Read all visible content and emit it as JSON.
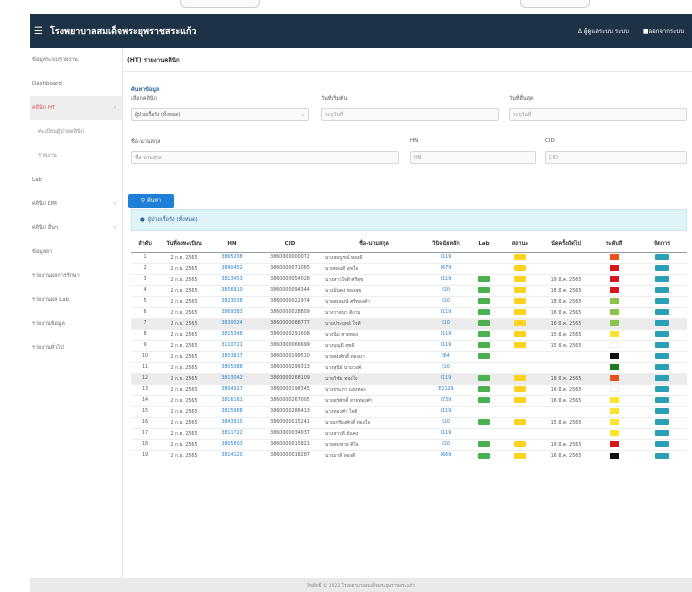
{
  "navbar": {
    "title": "โรงพยาบาลสมเด็จพระยุพราชสระแก้ว",
    "user_label": "Δ ผู้ดูแลระบบ ระบบ",
    "logout_label": "ออกจากระบบ"
  },
  "sidebar": {
    "items": [
      {
        "label": "ข้อมูลระบบรายงาน",
        "chevron": ""
      },
      {
        "label": "Dashboard",
        "chevron": ""
      },
      {
        "label": "คลินิก HT",
        "chevron": "‹"
      },
      {
        "label": "ทะเบียนผู้ป่วยคลินิก",
        "chevron": ""
      },
      {
        "label": "รายงาน",
        "chevron": ""
      },
      {
        "label": "Lab",
        "chevron": ""
      },
      {
        "label": "คลินิก DM",
        "chevron": "‹"
      },
      {
        "label": "คลินิก อื่นๆ",
        "chevron": "‹"
      },
      {
        "label": "ข้อมูลยา",
        "chevron": ""
      },
      {
        "label": "รายงานผลการรักษา",
        "chevron": ""
      },
      {
        "label": "รายงานผล Lab",
        "chevron": ""
      },
      {
        "label": "รายงานข้อมูล",
        "chevron": ""
      },
      {
        "label": "รายงานทั่วไป",
        "chevron": ""
      }
    ]
  },
  "breadcrumb": "(HT) รายงานคลินิก",
  "search": {
    "section_title": "ค้นหาข้อมูล",
    "clinic_label": "เลือกคลินิก",
    "clinic_value": "ผู้ป่วยเรื้อรัง (ทั้งหมด)",
    "start_label": "วันที่เริ่มต้น",
    "start_placeholder": "ระบุวันที่",
    "end_label": "วันที่สิ้นสุด",
    "end_placeholder": "ระบุวันที่",
    "name_label": "ชื่อ-นามสกุล",
    "name_placeholder": "ชื่อ-นามสกุล",
    "hn_label": "HN",
    "hn_placeholder": "HN",
    "cid_label": "CID",
    "cid_placeholder": "CID",
    "search_button": "ค้นหา"
  },
  "results": {
    "title": "ผู้ป่วยเรื้อรัง (ทั้งหมด)",
    "columns": [
      "ลำดับ",
      "วันที่ลงทะเบียน",
      "HN",
      "CID",
      "ชื่อ-นามสกุล",
      "วินิจฉัยหลัก",
      "Lab",
      "สถานะ",
      "นัดครั้งถัดไป",
      "ระดับสี",
      "จัดการ"
    ],
    "rows": [
      {
        "no": "1",
        "date": "2 ก.ย. 2565",
        "hn": "3865208",
        "cid": "3860000000072",
        "name": "นางสมบูรณ์ ทองดี",
        "dx": "I119",
        "lab": "",
        "status": "yellow",
        "appt": "",
        "color": "#e8521f",
        "action": "แก้ไข"
      },
      {
        "no": "2",
        "date": "2 ก.ย. 2565",
        "hn": "3840452",
        "cid": "3860000071065",
        "name": "นายทองดี สุขใจ",
        "dx": "I679",
        "lab": "",
        "status": "yellow",
        "appt": "",
        "color": "#d8151d",
        "action": "แก้ไข"
      },
      {
        "no": "3",
        "date": "2 ก.ย. 2565",
        "hn": "3813453",
        "cid": "3860000054028",
        "name": "นางสาวใจดี ศรีสุข",
        "dx": "I119",
        "lab": "green",
        "status": "yellow",
        "appt": "19 มี.ค. 2565",
        "color": "#d8151d",
        "action": "แก้ไข"
      },
      {
        "no": "4",
        "date": "2 ก.ย. 2565",
        "hn": "3856910",
        "cid": "3860000094344",
        "name": "นางมั่นคง ทองสุข",
        "dx": "I10",
        "lab": "green",
        "status": "yellow",
        "appt": "18 มี.ค. 2565",
        "color": "#d8151d",
        "action": "แก้ไข"
      },
      {
        "no": "5",
        "date": "2 ก.ย. 2565",
        "hn": "3823038",
        "cid": "3860000022974",
        "name": "นายสมพงษ์ ศรีทองคำ",
        "dx": "I10",
        "lab": "green",
        "status": "yellow",
        "appt": "18 มี.ค. 2565",
        "color": "#8bc34a",
        "action": "แก้ไข"
      },
      {
        "no": "6",
        "date": "2 ก.ย. 2565",
        "hn": "3869383",
        "cid": "3860000028809",
        "name": "นางวาสนา ดีงาม",
        "dx": "I119",
        "lab": "green",
        "status": "yellow",
        "appt": "16 มี.ค. 2565",
        "color": "#8bc34a",
        "action": "แก้ไข"
      },
      {
        "no": "7",
        "date": "2 ก.ย. 2565",
        "hn": "3830024",
        "cid": "3860000088777",
        "name": "นายประยุทธ์ ใจดี",
        "dx": "I10",
        "lab": "green",
        "status": "yellow",
        "appt": "16 มี.ค. 2565",
        "color": "#8bc34a",
        "action": "แก้ไข",
        "highlight": true
      },
      {
        "no": "8",
        "date": "2 ก.ย. 2565",
        "hn": "3815348",
        "cid": "3860000291608",
        "name": "นางนิ่ม สายทอง",
        "dx": "I119",
        "lab": "green",
        "status": "yellow",
        "appt": "15 มี.ค. 2565",
        "color": "#ffe22b",
        "action": "แก้ไข"
      },
      {
        "no": "9",
        "date": "2 ก.ย. 2565",
        "hn": "3110721",
        "cid": "3860000066699",
        "name": "นางบุญมี สุขดี",
        "dx": "I119",
        "lab": "green",
        "status": "yellow",
        "appt": "15 มี.ค. 2565",
        "color": "",
        "action": "แก้ไข"
      },
      {
        "no": "10",
        "date": "2 ก.ย. 2565",
        "hn": "3803817",
        "cid": "3860000199510",
        "name": "นายสมศักดิ์ ทองมา",
        "dx": "I64",
        "lab": "green",
        "status": "",
        "appt": "",
        "color": "#111111",
        "action": "แก้ไข"
      },
      {
        "no": "11",
        "date": "2 ก.ย. 2565",
        "hn": "3805388",
        "cid": "3860000299313",
        "name": "นางสุนีย์ นามวงศ์",
        "dx": "I10",
        "lab": "",
        "status": "",
        "appt": "",
        "color": "#1f7a1f",
        "action": "แก้ไข"
      },
      {
        "no": "12",
        "date": "2 ก.ย. 2565",
        "hn": "3813042",
        "cid": "3860000268109",
        "name": "นายวิชัย ทองใจ",
        "dx": "I119",
        "lab": "green",
        "status": "yellow",
        "appt": "18 มี.ค. 2565",
        "color": "#e8521f",
        "action": "แก้ไข",
        "highlight": true
      },
      {
        "no": "13",
        "date": "2 ก.ย. 2565",
        "hn": "3804327",
        "cid": "3860000198345",
        "name": "นางประภา แสงทอง",
        "dx": "E1129",
        "lab": "green",
        "status": "yellow",
        "appt": "16 มี.ค. 2565",
        "color": "",
        "action": "แก้ไข"
      },
      {
        "no": "14",
        "date": "2 ก.ย. 2565",
        "hn": "3816161",
        "cid": "3860000267005",
        "name": "นายสุรศักดิ์ สายทองคำ",
        "dx": "I739",
        "lab": "green",
        "status": "yellow",
        "appt": "16 มี.ค. 2565",
        "color": "#ffe22b",
        "action": "แก้ไข"
      },
      {
        "no": "15",
        "date": "2 ก.ย. 2565",
        "hn": "3815988",
        "cid": "3860000286413",
        "name": "นางทองคำ ใจดี",
        "dx": "I119",
        "lab": "",
        "status": "",
        "appt": "",
        "color": "#ffe22b",
        "action": "แก้ไข"
      },
      {
        "no": "16",
        "date": "2 ก.ย. 2565",
        "hn": "3843910",
        "cid": "3860000015241",
        "name": "นายเกรียงศักดิ์ ทองใจ",
        "dx": "I10",
        "lab": "green",
        "status": "yellow",
        "appt": "15 มี.ค. 2565",
        "color": "#ffe22b",
        "action": "แก้ไข"
      },
      {
        "no": "17",
        "date": "2 ก.ย. 2565",
        "hn": "3811722",
        "cid": "3860000034037",
        "name": "นางสาวดี มั่นคง",
        "dx": "I119",
        "lab": "",
        "status": "",
        "appt": "",
        "color": "#ffe22b",
        "action": "แก้ไข"
      },
      {
        "no": "18",
        "date": "2 ก.ย. 2565",
        "hn": "3805803",
        "cid": "3860000015821",
        "name": "นายสมชาย ดีใจ",
        "dx": "I10",
        "lab": "green",
        "status": "yellow",
        "appt": "19 มี.ค. 2565",
        "color": "#d8151d",
        "action": "แก้ไข"
      },
      {
        "no": "19",
        "date": "2 ก.ย. 2565",
        "hn": "3814120",
        "cid": "3860000018287",
        "name": "นางมาลี ทองดี",
        "dx": "I669",
        "lab": "green",
        "status": "yellow",
        "appt": "16 มี.ค. 2565",
        "color": "#111111",
        "action": "แก้ไข"
      }
    ]
  },
  "footer": "ลิขสิทธิ์ © 2022 โรงพยาบาลสมเด็จพระยุพราชสระแก้ว"
}
